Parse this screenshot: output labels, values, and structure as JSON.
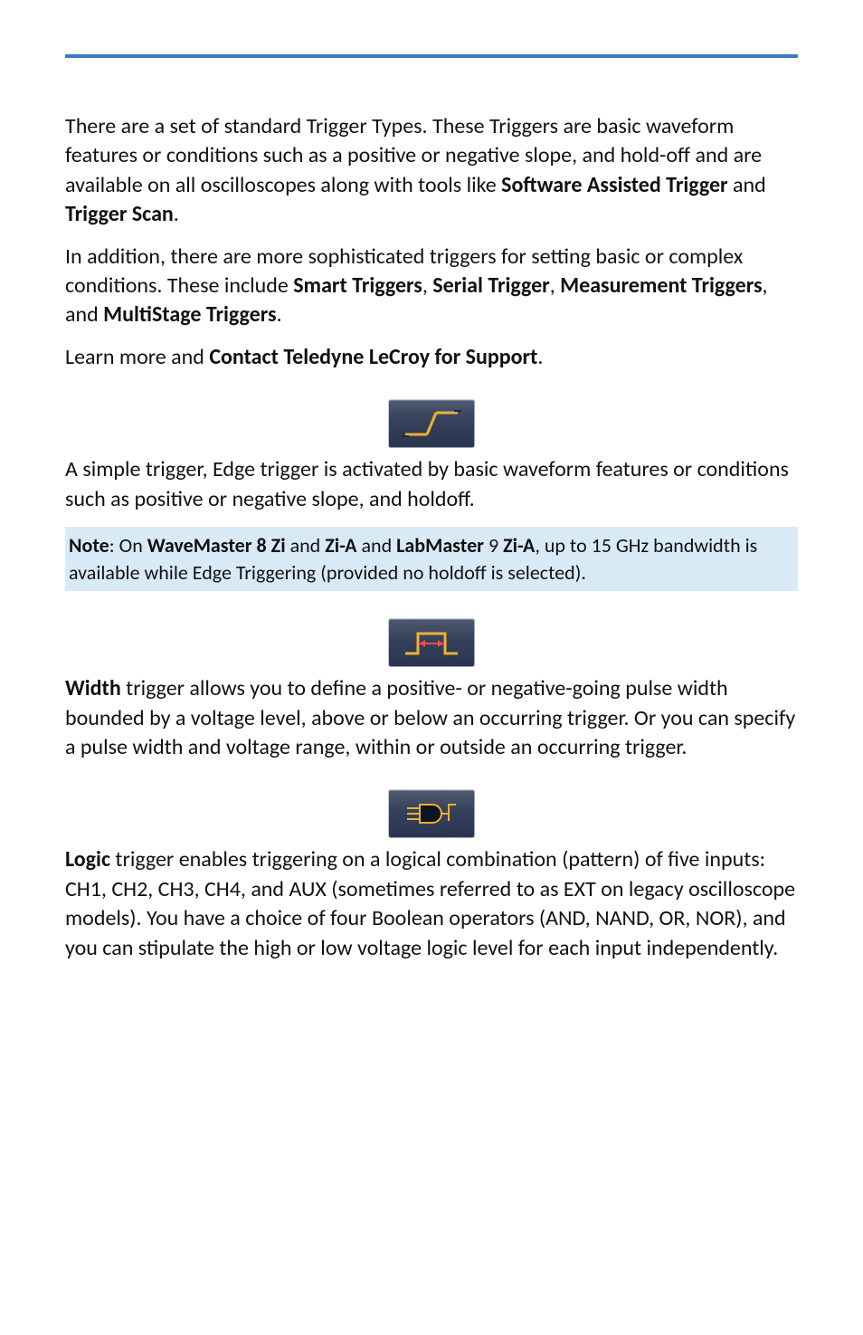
{
  "intro": {
    "p1_a": "There are a set of standard Trigger Types. These Triggers are basic waveform features or conditions such as a positive or negative slope, and hold-off and are available on all oscilloscopes along with tools like ",
    "p1_b": "Software Assisted Trigger",
    "p1_c": " and ",
    "p1_d": "Trigger Scan",
    "p1_e": ".",
    "p2_a": "In addition, there are more sophisticated triggers for setting basic or complex conditions. These include ",
    "p2_b": "Smart Triggers",
    "p2_c": ", ",
    "p2_d": "Serial Trigger",
    "p2_e": ", ",
    "p2_f": "Measurement Triggers",
    "p2_g": ", and ",
    "p2_h": "MultiStage Triggers",
    "p2_i": ".",
    "p3_a": "Learn more and ",
    "p3_b": "Contact Teledyne LeCroy for Support",
    "p3_c": "."
  },
  "edge": {
    "icon_name": "edge-trigger-icon",
    "body": "A simple trigger, Edge trigger is activated by basic waveform features or conditions such as positive or negative slope, and holdoff.",
    "note_a": "Note",
    "note_b": ": On ",
    "note_c": "WaveMaster 8 Zi",
    "note_d": " and ",
    "note_e": "Zi-A",
    "note_f": " and ",
    "note_g": "LabMaster",
    "note_h": " 9 ",
    "note_i": "Zi-A",
    "note_j": ", up to 15 GHz bandwidth is available while Edge Triggering (provided no holdoff is selected)."
  },
  "width": {
    "icon_name": "width-trigger-icon",
    "lead": "Width",
    "body": " trigger allows you to define a positive- or negative-going pulse width bounded by a voltage level, above or below an occurring trigger. Or you can specify a pulse width and voltage range, within or outside an occurring trigger."
  },
  "logic": {
    "icon_name": "logic-trigger-icon",
    "lead": "Logic",
    "body": " trigger enables triggering on a logical combination (pattern) of five inputs: CH1, CH2, CH3, CH4, and AUX (sometimes referred to as EXT on legacy oscilloscope models). You have a choice of four Boolean operators (AND, NAND, OR, NOR), and you can stipulate the high or low voltage logic level for each input independently."
  }
}
